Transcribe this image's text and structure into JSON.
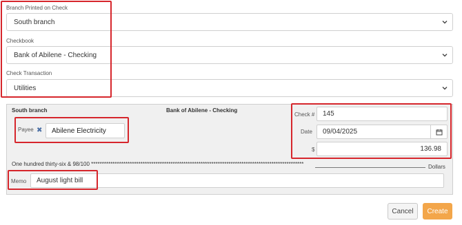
{
  "form": {
    "branch": {
      "label": "Branch Printed on Check",
      "value": "South branch"
    },
    "checkbook": {
      "label": "Checkbook",
      "value": "Bank of Abilene - Checking"
    },
    "transaction": {
      "label": "Check Transaction",
      "value": "Utilities"
    }
  },
  "check": {
    "branch_name": "South branch",
    "bank_name": "Bank of Abilene - Checking",
    "payee_label": "Payee",
    "payee_value": "Abilene Electricity",
    "check_no_label": "Check #",
    "check_no": "145",
    "date_label": "Date",
    "date": "09/04/2025",
    "amount_label": "$",
    "amount": "136.98",
    "amount_words": "One hundred thirty-six & 98/100 ***************************************************************************************************",
    "dollars_label": "Dollars",
    "memo_label": "Memo",
    "memo": "August light bill"
  },
  "buttons": {
    "cancel": "Cancel",
    "create": "Create"
  },
  "colors": {
    "highlight": "#d6252b",
    "primary": "#f3a64a",
    "panel": "#f0f0f0"
  },
  "icons": [
    "chevron-down-icon",
    "remove-icon",
    "calendar-icon"
  ]
}
